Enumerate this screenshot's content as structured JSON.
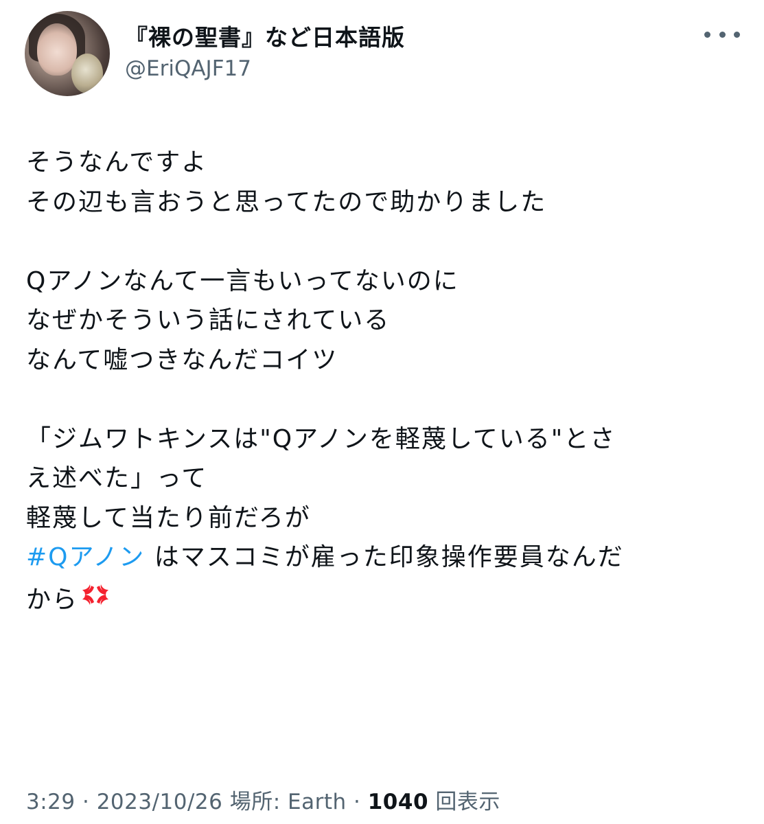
{
  "author": {
    "display_name": "『裸の聖書』など日本語版",
    "handle": "@EriQAJF17"
  },
  "tweet": {
    "lines": [
      "そうなんですよ",
      "その辺も言おうと思ってたので助かりました",
      "",
      "Qアノンなんて一言もいってないのに",
      "なぜかそういう話にされている",
      "なんて嘘つきなんだコイツ",
      "",
      "「ジムワトキンスは\"Qアノンを軽蔑している\"とさ",
      "え述べた」って",
      "軽蔑して当たり前だろが"
    ],
    "hashtag": "#Qアノン",
    "after_hashtag": " はマスコミが雇った印象操作要員なんだ",
    "last_line": "から",
    "emoji_icon": "anger-symbol-icon"
  },
  "meta": {
    "time": "3:29",
    "sep1": " · ",
    "date": "2023/10/26",
    "location": " 場所: Earth",
    "sep2": " · ",
    "views_count": "1040",
    "views_label": " 回表示"
  },
  "colors": {
    "text": "#0f1419",
    "secondary": "#536471",
    "link": "#1d9bf0",
    "anger": "#f4212e"
  }
}
